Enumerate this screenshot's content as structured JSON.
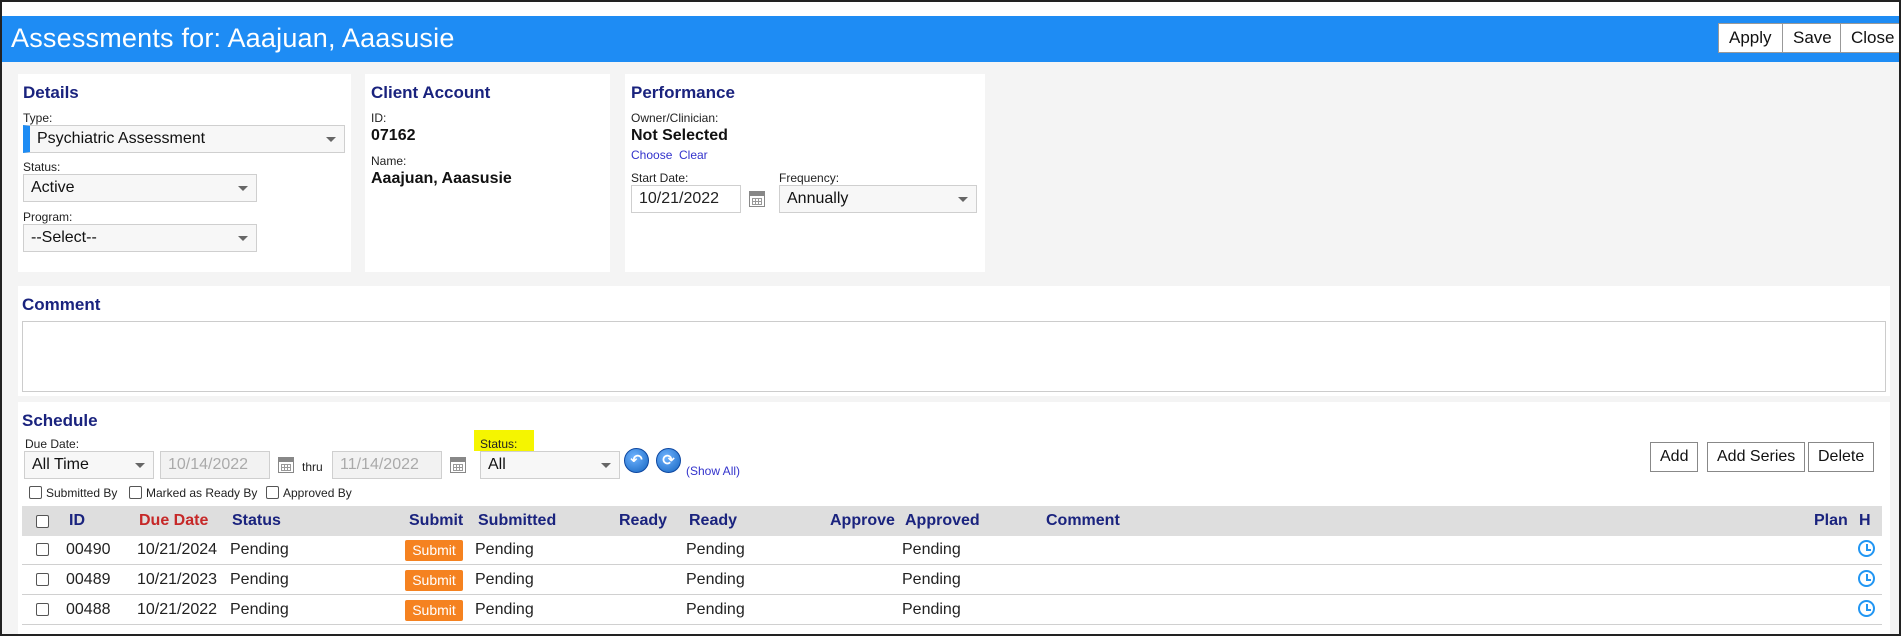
{
  "title": "Assessments for: Aaajuan, Aaasusie",
  "toolbar": {
    "apply": "Apply",
    "save": "Save",
    "close": "Close"
  },
  "details": {
    "heading": "Details",
    "type_label": "Type:",
    "type_value": "Psychiatric Assessment",
    "status_label": "Status:",
    "status_value": "Active",
    "program_label": "Program:",
    "program_value": "--Select--"
  },
  "client": {
    "heading": "Client Account",
    "id_label": "ID:",
    "id_value": "07162",
    "name_label": "Name:",
    "name_value": "Aaajuan, Aaasusie"
  },
  "performance": {
    "heading": "Performance",
    "owner_label": "Owner/Clinician:",
    "owner_value": "Not Selected",
    "choose": "Choose",
    "clear": "Clear",
    "start_label": "Start Date:",
    "start_value": "10/21/2022",
    "freq_label": "Frequency:",
    "freq_value": "Annually"
  },
  "comment": {
    "heading": "Comment",
    "value": ""
  },
  "schedule": {
    "heading": "Schedule",
    "due_label": "Due Date:",
    "due_value": "All Time",
    "from_date": "10/14/2022",
    "thru": "thru",
    "to_date": "11/14/2022",
    "status_label": "Status:",
    "status_value": "All",
    "show_all": "(Show All)",
    "add": "Add",
    "add_series": "Add Series",
    "delete": "Delete",
    "filters": [
      "Submitted By",
      "Marked as Ready By",
      "Approved By"
    ],
    "columns": {
      "id": "ID",
      "due": "Due Date",
      "status": "Status",
      "submit": "Submit",
      "submitted": "Submitted",
      "ready": "Ready",
      "ready2": "Ready",
      "approve": "Approve",
      "approved": "Approved",
      "comment": "Comment",
      "plan": "Plan",
      "h": "H"
    },
    "rows": [
      {
        "id": "00490",
        "due": "10/21/2024",
        "status": "Pending",
        "submit": "Submit",
        "submitted": "Pending",
        "ready": "Pending",
        "approved": "Pending"
      },
      {
        "id": "00489",
        "due": "10/21/2023",
        "status": "Pending",
        "submit": "Submit",
        "submitted": "Pending",
        "ready": "Pending",
        "approved": "Pending"
      },
      {
        "id": "00488",
        "due": "10/21/2022",
        "status": "Pending",
        "submit": "Submit",
        "submitted": "Pending",
        "ready": "Pending",
        "approved": "Pending"
      }
    ]
  },
  "colors": {
    "titlebar": "#1e8cf4",
    "heading": "#1a237e",
    "submit": "#f58220",
    "highlight": "#f5f500"
  }
}
